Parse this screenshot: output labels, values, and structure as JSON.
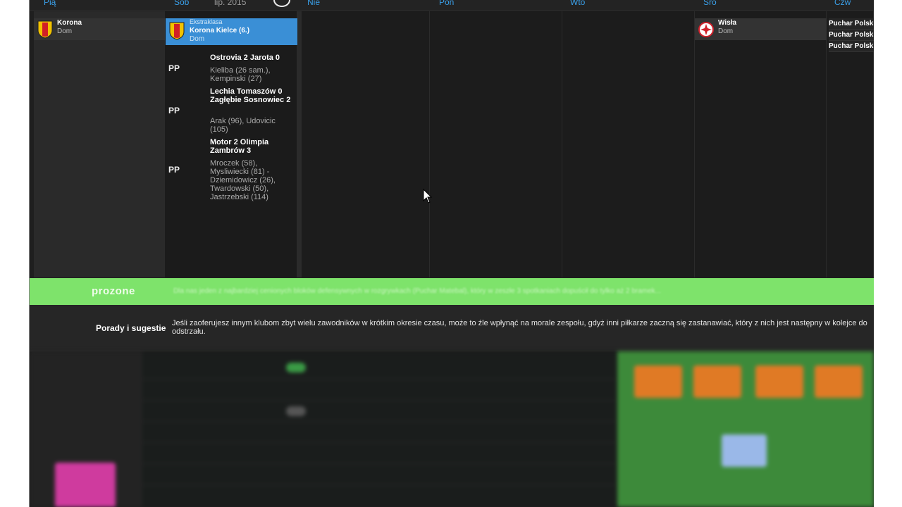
{
  "calendar": {
    "days": [
      "Pią",
      "Sob",
      "Nie",
      "Pon",
      "Wto",
      "Śro",
      "Czw"
    ],
    "month_label": "lip. 2015"
  },
  "events": {
    "pia": {
      "team": "Korona",
      "venue": "Dom"
    },
    "sob": {
      "competition": "Ekstraklasa",
      "team": "Korona Kielce (6.)",
      "venue": "Dom"
    },
    "sro": {
      "team": "Wisła",
      "venue": "Dom"
    },
    "czw": [
      "Puchar Polski",
      "Puchar Polski",
      "Puchar Polski"
    ]
  },
  "results": [
    {
      "code": "PP",
      "score": "Ostrovia 2 Jarota 0",
      "scorers": "Kieliba (26 sam.), Kempinski (27)"
    },
    {
      "code": "PP",
      "score": "Lechia Tomaszów 0 Zagłębie Sosnowiec 2",
      "scorers": "Arak (96), Udovicic (105)"
    },
    {
      "code": "PP",
      "score": "Motor 2 Olimpia Zambrów 3",
      "scorers": "Mroczek (58), Mysliwiecki (81) - Dziemidowicz (26), Twardowski (50), Jastrzebski (114)"
    }
  ],
  "banner": {
    "logo": "prozone",
    "text": "Dla nas jeden z najbardziej cenionych bloków defensywnych w rozgrywkach (Puchar Matebal), który w zeszłe 3 spotkaniach dopuścił do tylko aż 2 bramek..."
  },
  "tips": {
    "title": "Porady i sugestie",
    "text": "Jeśli zaoferujesz innym klubom zbyt wielu zawodników w krótkim okresie czasu, może to źle wpłynąć na morale zespołu, gdyż inni piłkarze zaczną się zastanawiać, który z nich jest następny w kolejce do odstrzału."
  },
  "colors": {
    "accent": "#3a9fe8",
    "selected_event": "#3a8fd6",
    "banner": "#7ee36b",
    "korona_yellow": "#f2c200",
    "korona_red": "#d11f26",
    "wisla_red": "#d0202a"
  }
}
